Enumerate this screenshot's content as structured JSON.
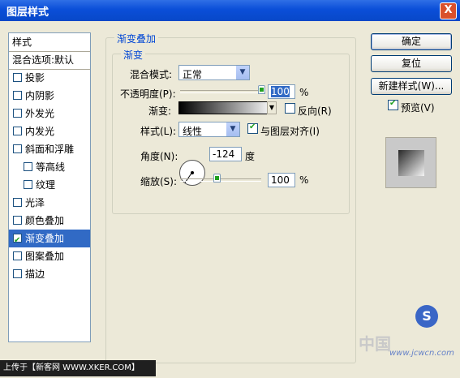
{
  "window": {
    "title": "图层样式",
    "close": "X"
  },
  "style_list": {
    "header": "样式",
    "blend_default": "混合选项:默认",
    "items": [
      {
        "label": "投影",
        "checked": false
      },
      {
        "label": "内阴影",
        "checked": false
      },
      {
        "label": "外发光",
        "checked": false
      },
      {
        "label": "内发光",
        "checked": false
      },
      {
        "label": "斜面和浮雕",
        "checked": false
      },
      {
        "label": "等高线",
        "checked": false
      },
      {
        "label": "纹理",
        "checked": false
      },
      {
        "label": "光泽",
        "checked": false
      },
      {
        "label": "颜色叠加",
        "checked": false
      },
      {
        "label": "渐变叠加",
        "checked": true,
        "selected": true
      },
      {
        "label": "图案叠加",
        "checked": false
      },
      {
        "label": "描边",
        "checked": false
      }
    ]
  },
  "panel": {
    "group_title": "渐变叠加",
    "sub_title": "渐变",
    "blend_mode_label": "混合模式:",
    "blend_mode_value": "正常",
    "opacity_label": "不透明度(P):",
    "opacity_value": "100",
    "opacity_unit": "%",
    "gradient_label": "渐变:",
    "reverse_label": "反向(R)",
    "reverse_checked": false,
    "style_label": "样式(L):",
    "style_value": "线性",
    "align_label": "与图层对齐(I)",
    "align_checked": true,
    "angle_label": "角度(N):",
    "angle_value": "-124",
    "angle_unit": "度",
    "scale_label": "缩放(S):",
    "scale_value": "100",
    "scale_unit": "%",
    "opacity_level": 1.0,
    "scale_level": 0.45
  },
  "buttons": {
    "ok": "确定",
    "reset": "复位",
    "new_style": "新建样式(W)...",
    "preview_label": "预览(V)",
    "preview_checked": true
  },
  "footer": "上传于【新客网 WWW.XKER.COM】",
  "watermark": {
    "zh": "中国",
    "site": "www.jcwcn.com",
    "logo": "S"
  },
  "colors": {
    "title_bar": "#0A4ED8",
    "selection": "#316AC5",
    "accent_text": "#0046D5"
  }
}
